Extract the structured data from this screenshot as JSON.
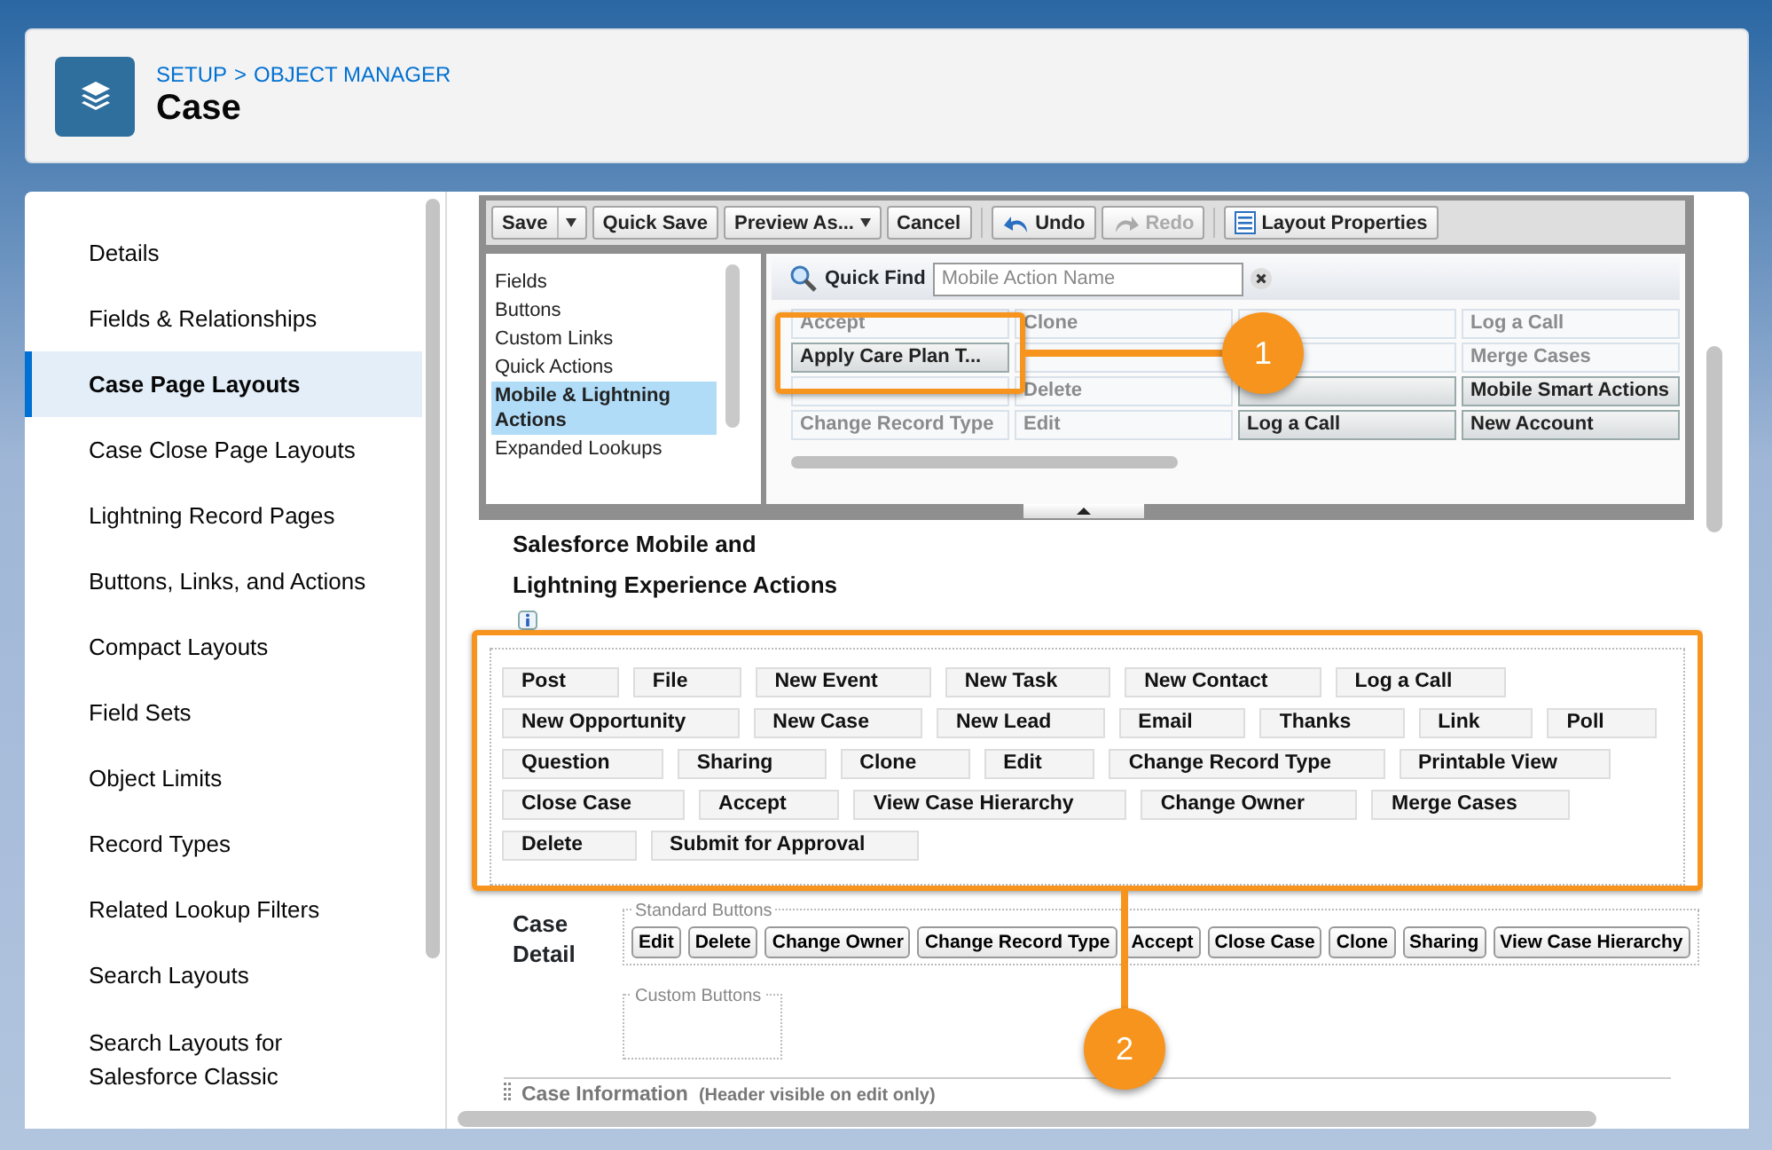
{
  "header": {
    "breadcrumb": [
      {
        "label": "SETUP"
      },
      {
        "label": "OBJECT MANAGER"
      }
    ],
    "separator": ">",
    "title": "Case"
  },
  "sidebar": {
    "items": [
      {
        "label": "Details",
        "selected": false
      },
      {
        "label": "Fields & Relationships",
        "selected": false
      },
      {
        "label": "Case Page Layouts",
        "selected": true
      },
      {
        "label": "Case Close Page Layouts",
        "selected": false
      },
      {
        "label": "Lightning Record Pages",
        "selected": false
      },
      {
        "label": "Buttons, Links, and Actions",
        "selected": false
      },
      {
        "label": "Compact Layouts",
        "selected": false
      },
      {
        "label": "Field Sets",
        "selected": false
      },
      {
        "label": "Object Limits",
        "selected": false
      },
      {
        "label": "Record Types",
        "selected": false
      },
      {
        "label": "Related Lookup Filters",
        "selected": false
      },
      {
        "label": "Search Layouts",
        "selected": false
      },
      {
        "label": "Search Layouts for Salesforce Classic",
        "selected": false
      }
    ]
  },
  "toolbar": {
    "groups": [
      {
        "items": [
          {
            "label": "Save",
            "kind": "split",
            "disabled": false
          },
          {
            "label": "Quick Save",
            "kind": "plain",
            "disabled": false
          },
          {
            "label": "Preview As...",
            "kind": "menu",
            "disabled": false
          },
          {
            "label": "Cancel",
            "kind": "plain",
            "disabled": false
          }
        ]
      },
      {
        "items": [
          {
            "label": "Undo",
            "kind": "undo",
            "disabled": false
          },
          {
            "label": "Redo",
            "kind": "redo",
            "disabled": true
          }
        ]
      },
      {
        "items": [
          {
            "label": "Layout Properties",
            "kind": "properties",
            "disabled": false
          }
        ]
      }
    ]
  },
  "palette": {
    "categories": [
      {
        "label": "Fields",
        "selected": false
      },
      {
        "label": "Buttons",
        "selected": false
      },
      {
        "label": "Custom Links",
        "selected": false
      },
      {
        "label": "Quick Actions",
        "selected": false
      },
      {
        "label": "Mobile & Lightning Actions",
        "selected": true
      },
      {
        "label": "Expanded Lookups",
        "selected": false
      }
    ],
    "quick_find": {
      "label": "Quick Find",
      "placeholder": "Mobile Action Name"
    },
    "items": [
      {
        "label": "Accept",
        "used": true
      },
      {
        "label": "Clone",
        "used": true
      },
      {
        "used": true
      },
      {
        "label": "Log a Call",
        "used": true
      },
      {
        "label": "Apply Care Plan T...",
        "used": false
      },
      {
        "used": true
      },
      {
        "used": true
      },
      {
        "label": "Merge Cases",
        "used": true
      },
      {
        "used": true
      },
      {
        "label": "Delete",
        "used": true
      },
      {
        "used": false
      },
      {
        "label": "Mobile Smart Actions",
        "used": false
      },
      {
        "label": "Change Record Type",
        "used": true
      },
      {
        "label": "Edit",
        "used": true
      },
      {
        "label": "Log a Call",
        "used": false
      },
      {
        "label": "New Account",
        "used": false
      }
    ]
  },
  "actions_section": {
    "title": "Salesforce Mobile and Lightning Experience Actions",
    "actions": [
      "Post",
      "File",
      "New Event",
      "New Task",
      "New Contact",
      "Log a Call",
      "New Opportunity",
      "New Case",
      "New Lead",
      "Email",
      "Thanks",
      "Link",
      "Poll",
      "Question",
      "Sharing",
      "Clone",
      "Edit",
      "Change Record Type",
      "Printable View",
      "Close Case",
      "Accept",
      "View Case Hierarchy",
      "Change Owner",
      "Merge Cases",
      "Delete",
      "Submit for Approval"
    ]
  },
  "case_detail": {
    "title": "Case Detail",
    "standard_buttons": {
      "legend": "Standard Buttons",
      "items": [
        "Edit",
        "Delete",
        "Change Owner",
        "Change Record Type",
        "Accept",
        "Close Case",
        "Clone",
        "Sharing",
        "View Case Hierarchy"
      ]
    },
    "custom_buttons": {
      "legend": "Custom Buttons"
    }
  },
  "case_information": {
    "title": "Case Information",
    "note": "(Header visible on edit only)"
  },
  "callouts": [
    {
      "number": "1"
    },
    {
      "number": "2"
    }
  ]
}
